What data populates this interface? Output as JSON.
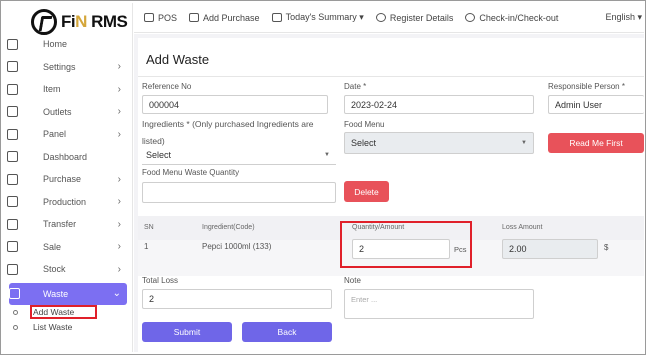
{
  "brand": {
    "fi": "Fi",
    "n": "N",
    "rms": " RMS"
  },
  "sidebar": {
    "items": [
      {
        "label": "Home",
        "arrow": ""
      },
      {
        "label": "Settings",
        "arrow": "›"
      },
      {
        "label": "Item",
        "arrow": "›"
      },
      {
        "label": "Outlets",
        "arrow": "›"
      },
      {
        "label": "Panel",
        "arrow": "›"
      },
      {
        "label": "Dashboard",
        "arrow": ""
      },
      {
        "label": "Purchase",
        "arrow": "›"
      },
      {
        "label": "Production",
        "arrow": "›"
      },
      {
        "label": "Transfer",
        "arrow": "›"
      },
      {
        "label": "Sale",
        "arrow": "›"
      },
      {
        "label": "Stock",
        "arrow": "›"
      }
    ],
    "active": {
      "label": "Waste",
      "arrow": "⌄"
    },
    "subitems": [
      {
        "label": "Add Waste"
      },
      {
        "label": "List Waste"
      }
    ]
  },
  "topbar": {
    "pos": "POS",
    "add_purchase": "Add Purchase",
    "todays_summary": "Today's Summary ▾",
    "register_details": "Register Details",
    "check_in_out": "Check-in/Check-out",
    "language": "English ▾"
  },
  "page": {
    "title": "Add Waste",
    "reference_label": "Reference No",
    "reference_value": "000004",
    "date_label": "Date *",
    "date_value": "2023-02-24",
    "responsible_label": "Responsible Person *",
    "responsible_value": "Admin User",
    "ingredients_label": "Ingredients * (Only purchased Ingredients are listed)",
    "ingredients_value": "Select",
    "food_menu_label": "Food Menu",
    "food_menu_value": "Select",
    "read_me_first": "Read Me First",
    "food_menu_qty_label": "Food Menu Waste Quantity",
    "delete": "Delete",
    "table": {
      "headers": [
        "SN",
        "Ingredient(Code)",
        "Quantity/Amount",
        "Loss Amount"
      ],
      "rows": [
        {
          "sn": "1",
          "ingredient": "Pepci 1000ml (133)",
          "quantity": "2",
          "unit": "Pcs",
          "loss": "2.00",
          "currency": "$"
        }
      ]
    },
    "total_loss_label": "Total Loss",
    "total_loss_value": "2",
    "note_label": "Note",
    "note_placeholder": "Enter ...",
    "submit": "Submit",
    "back": "Back"
  },
  "colors": {
    "active_nav": "#7c6ff2",
    "primary_button": "#6f66e8",
    "danger_button": "#e8525a",
    "highlight": "#e0202a"
  }
}
